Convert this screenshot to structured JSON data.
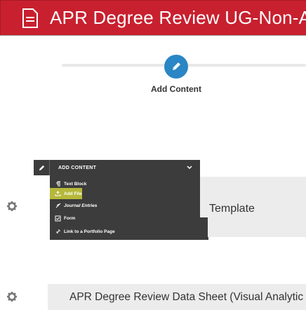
{
  "header": {
    "title": "APR Degree Review UG-Non-Ac",
    "color": "#c8202f",
    "icon": "document-icon"
  },
  "steps": {
    "add_content_label": "Add Content",
    "icon": "pencil-icon",
    "color": "#2a86c5"
  },
  "dropdown": {
    "header_label": "ADD CONTENT",
    "items": [
      {
        "label": "Text Block",
        "icon": "paragraph-icon"
      },
      {
        "label": "Add File",
        "icon": "file-upload-icon"
      },
      {
        "label": "Journal Entries",
        "icon": "quill-icon"
      },
      {
        "label": "Form",
        "icon": "checkbox-icon"
      },
      {
        "label": "Link to a Portfolio Page",
        "icon": "link-icon"
      }
    ],
    "highlight_color": "#b5b83a"
  },
  "sections": {
    "template_label": "Template",
    "data_sheet_label": "APR Degree Review Data Sheet (Visual Analytic"
  }
}
